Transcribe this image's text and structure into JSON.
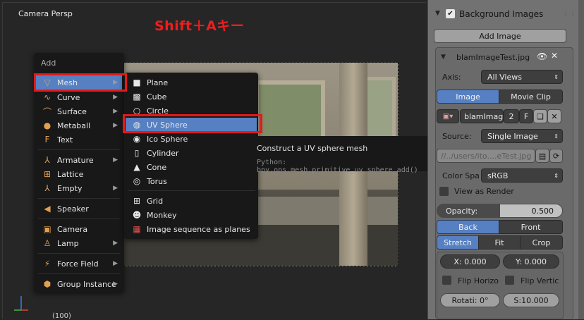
{
  "viewport": {
    "title": "Camera Persp",
    "shortcut_note": "Shift＋Aキー",
    "frame_number": "(100)"
  },
  "add_menu": {
    "title": "Add",
    "items": [
      {
        "label": "Mesh",
        "icon": "mesh-icon",
        "submenu": true,
        "selected": true
      },
      {
        "label": "Curve",
        "icon": "curve-icon",
        "submenu": true
      },
      {
        "label": "Surface",
        "icon": "surface-icon",
        "submenu": true
      },
      {
        "label": "Metaball",
        "icon": "metaball-icon",
        "submenu": true
      },
      {
        "label": "Text",
        "icon": "text-icon",
        "submenu": false
      },
      {
        "label": "Armature",
        "icon": "armature-icon",
        "submenu": true
      },
      {
        "label": "Lattice",
        "icon": "lattice-icon",
        "submenu": false
      },
      {
        "label": "Empty",
        "icon": "empty-icon",
        "submenu": true
      },
      {
        "label": "Speaker",
        "icon": "speaker-icon",
        "submenu": false
      },
      {
        "label": "Camera",
        "icon": "camera-icon",
        "submenu": false
      },
      {
        "label": "Lamp",
        "icon": "lamp-icon",
        "submenu": true
      },
      {
        "label": "Force Field",
        "icon": "force-field-icon",
        "submenu": true
      },
      {
        "label": "Group Instance",
        "icon": "group-instance-icon",
        "submenu": true
      }
    ]
  },
  "mesh_menu": {
    "items": [
      {
        "label": "Plane",
        "icon": "plane-icon"
      },
      {
        "label": "Cube",
        "icon": "cube-icon"
      },
      {
        "label": "Circle",
        "icon": "circle-icon"
      },
      {
        "label": "UV Sphere",
        "icon": "uv-sphere-icon",
        "selected": true
      },
      {
        "label": "Ico Sphere",
        "icon": "ico-sphere-icon"
      },
      {
        "label": "Cylinder",
        "icon": "cylinder-icon"
      },
      {
        "label": "Cone",
        "icon": "cone-icon"
      },
      {
        "label": "Torus",
        "icon": "torus-icon"
      },
      {
        "label": "Grid",
        "icon": "grid-icon"
      },
      {
        "label": "Monkey",
        "icon": "monkey-icon"
      },
      {
        "label": "Image sequence as planes",
        "icon": "image-sequence-icon"
      }
    ]
  },
  "tooltip": {
    "title": "Construct a UV sphere mesh",
    "python": "Python: bpy.ops.mesh.primitive_uv_sphere_add()"
  },
  "panel": {
    "header": "Background Images",
    "add_image": "Add Image",
    "image_name": "blamImageTest.jpg",
    "axis_label": "Axis:",
    "axis_value": "All Views",
    "tab_image": "Image",
    "tab_movie": "Movie Clip",
    "datablock_name": "blamImag",
    "datablock_users": "2",
    "datablock_fake": "F",
    "source_label": "Source:",
    "source_value": "Single Image",
    "filepath": "//../users/ito....eTest.jpg",
    "color_space_label": "Color Spa",
    "color_space_value": "sRGB",
    "view_as_render": "View as Render",
    "opacity_label": "Opacity:",
    "opacity_value": "0.500",
    "opacity": 0.5,
    "back": "Back",
    "front": "Front",
    "stretch": "Stretch",
    "fit": "Fit",
    "crop": "Crop",
    "x_field": "X:  0.000",
    "y_field": "Y:  0.000",
    "flip_h": "Flip Horizo",
    "flip_v": "Flip Vertic",
    "rotation": "Rotati: 0°",
    "size": "S:10.000"
  },
  "colors": {
    "accent": "#5680c2",
    "highlight": "#e21a1a"
  }
}
